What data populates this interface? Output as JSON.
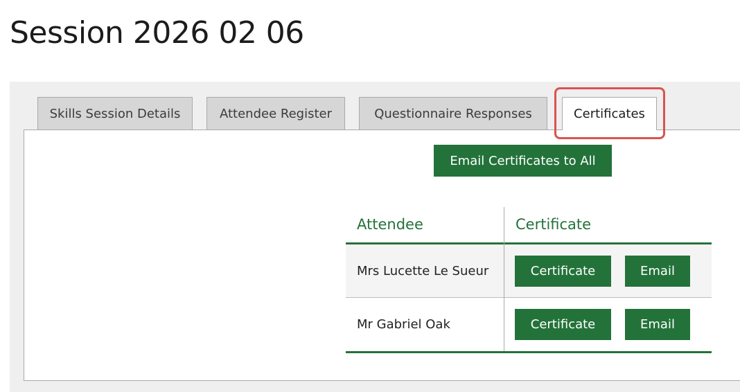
{
  "page": {
    "title": "Session 2026 02 06"
  },
  "tabs": [
    {
      "label": "Skills Session Details",
      "active": false
    },
    {
      "label": "Attendee Register",
      "active": false
    },
    {
      "label": "Questionnaire Responses",
      "active": false
    },
    {
      "label": "Certificates",
      "active": true
    }
  ],
  "certificates": {
    "email_all_label": "Email Certificates to All",
    "columns": [
      "Attendee",
      "Certificate"
    ],
    "rows": [
      {
        "attendee": "Mrs Lucette Le Sueur",
        "certificate_label": "Certificate",
        "email_label": "Email"
      },
      {
        "attendee": "Mr Gabriel Oak",
        "certificate_label": "Certificate",
        "email_label": "Email"
      }
    ]
  },
  "colors": {
    "accent": "#23723a",
    "highlight": "#d9534f"
  }
}
